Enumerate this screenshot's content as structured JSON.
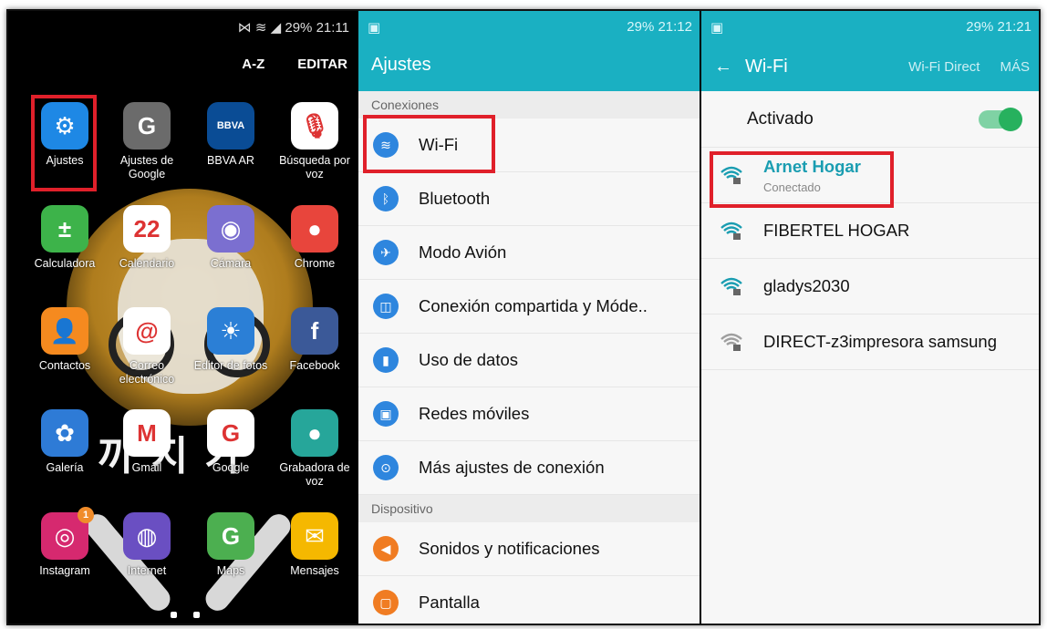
{
  "home": {
    "status": "29% 21:11",
    "menu": {
      "az": "A-Z",
      "edit": "EDITAR"
    },
    "wallpaper_text": "까 지 가",
    "apps": [
      {
        "label": "Ajustes",
        "icon": "gear-icon",
        "color": "#1e88e5",
        "glyph": "⚙"
      },
      {
        "label": "Ajustes de Google",
        "icon": "google-settings-icon",
        "color": "#6b6b6b",
        "glyph": "G"
      },
      {
        "label": "BBVA AR",
        "icon": "bbva-icon",
        "color": "#0a4c95",
        "glyph": "BBVA"
      },
      {
        "label": "Búsqueda por voz",
        "icon": "microphone-icon",
        "color": "#ffffff",
        "glyph": "🎙"
      },
      {
        "label": "Calculadora",
        "icon": "calculator-icon",
        "color": "#3db34a",
        "glyph": "±"
      },
      {
        "label": "Calendario",
        "icon": "calendar-icon",
        "color": "#ffffff",
        "glyph": "22"
      },
      {
        "label": "Cámara",
        "icon": "camera-icon",
        "color": "#7b6fd0",
        "glyph": "◉"
      },
      {
        "label": "Chrome",
        "icon": "chrome-icon",
        "color": "#e8453c",
        "glyph": "●"
      },
      {
        "label": "Contactos",
        "icon": "contacts-icon",
        "color": "#f58a1f",
        "glyph": "👤"
      },
      {
        "label": "Correo electrónico",
        "icon": "email-icon",
        "color": "#ffffff",
        "glyph": "@"
      },
      {
        "label": "Editor de fotos",
        "icon": "photo-editor-icon",
        "color": "#2b7fd6",
        "glyph": "☀"
      },
      {
        "label": "Facebook",
        "icon": "facebook-icon",
        "color": "#3b5998",
        "glyph": "f"
      },
      {
        "label": "Galería",
        "icon": "gallery-icon",
        "color": "#2e7bd6",
        "glyph": "✿"
      },
      {
        "label": "Gmail",
        "icon": "gmail-icon",
        "color": "#ffffff",
        "glyph": "M"
      },
      {
        "label": "Google",
        "icon": "google-icon",
        "color": "#ffffff",
        "glyph": "G"
      },
      {
        "label": "Grabadora de voz",
        "icon": "voice-recorder-icon",
        "color": "#26a69a",
        "glyph": "●"
      },
      {
        "label": "Instagram",
        "icon": "instagram-icon",
        "color": "#d6296f",
        "glyph": "◎",
        "badge": "1"
      },
      {
        "label": "Internet",
        "icon": "internet-icon",
        "color": "#6a4fc2",
        "glyph": "◍"
      },
      {
        "label": "Maps",
        "icon": "maps-icon",
        "color": "#4caf50",
        "glyph": "G"
      },
      {
        "label": "Mensajes",
        "icon": "messages-icon",
        "color": "#f5b800",
        "glyph": "✉"
      }
    ]
  },
  "settings": {
    "status_time": "29% 21:12",
    "title": "Ajustes",
    "section_conexiones": "Conexiones",
    "section_dispositivo": "Dispositivo",
    "connections": [
      {
        "label": "Wi-Fi",
        "icon": "wifi-icon",
        "color": "#2e86de",
        "glyph": "≋"
      },
      {
        "label": "Bluetooth",
        "icon": "bluetooth-icon",
        "color": "#2e86de",
        "glyph": "ᛒ"
      },
      {
        "label": "Modo Avión",
        "icon": "airplane-icon",
        "color": "#2e86de",
        "glyph": "✈"
      },
      {
        "label": "Conexión compartida y Móde..",
        "icon": "hotspot-icon",
        "color": "#2e86de",
        "glyph": "◫"
      },
      {
        "label": "Uso de datos",
        "icon": "data-usage-icon",
        "color": "#2e86de",
        "glyph": "▮"
      },
      {
        "label": "Redes móviles",
        "icon": "mobile-networks-icon",
        "color": "#2e86de",
        "glyph": "▣"
      },
      {
        "label": "Más ajustes de conexión",
        "icon": "more-connection-icon",
        "color": "#2e86de",
        "glyph": "⊙"
      }
    ],
    "device": [
      {
        "label": "Sonidos y notificaciones",
        "icon": "sound-icon",
        "color": "#f07c22",
        "glyph": "◀"
      },
      {
        "label": "Pantalla",
        "icon": "display-icon",
        "color": "#f07c22",
        "glyph": "▢"
      }
    ]
  },
  "wifi": {
    "status_time": "29% 21:21",
    "title": "Wi-Fi",
    "wifi_direct": "Wi-Fi Direct",
    "more": "MÁS",
    "activated": "Activado",
    "toggle_on": true,
    "networks": [
      {
        "name": "Arnet Hogar",
        "status": "Conectado",
        "connected": true,
        "color": "#1a9db1"
      },
      {
        "name": "FIBERTEL HOGAR",
        "connected": false,
        "color": "#1a9db1"
      },
      {
        "name": "gladys2030",
        "connected": false,
        "color": "#1a9db1"
      },
      {
        "name": "DIRECT-z3impresora samsung",
        "connected": false,
        "color": "#9e9e9e"
      }
    ]
  }
}
